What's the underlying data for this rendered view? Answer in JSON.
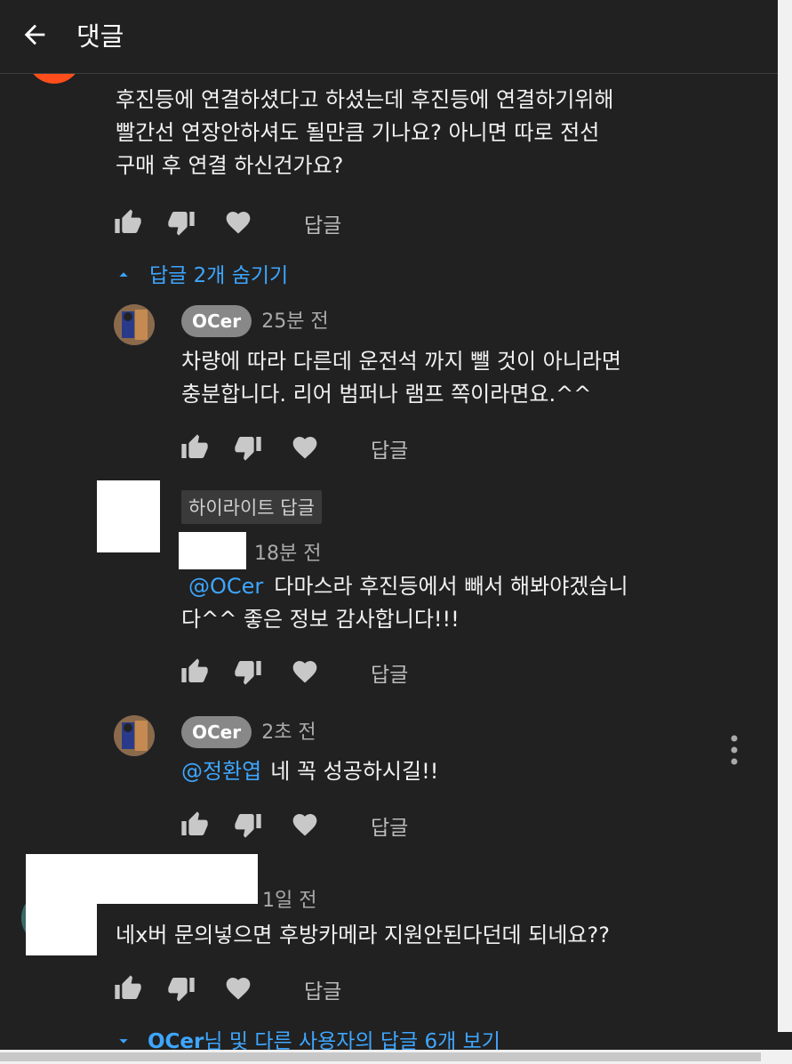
{
  "header": {
    "title": "댓글",
    "back_icon": "arrow-left-icon"
  },
  "top_comment": {
    "text_lines": [
      "후진등에 연결하셨다고 하셨는데 후진등에 연결하기위해",
      "빨간선 연장안하셔도 될만큼 기나요? 아니면 따로 전선",
      "구매 후 연결 하신건가요?"
    ],
    "reply_label": "답글",
    "hide_replies": "답글 2개 숨기기"
  },
  "replies": [
    {
      "author": "OCer",
      "time": "25분 전",
      "text_lines": [
        "차량에 따라 다른데 운전석 까지 뺄 것이 아니라면",
        "충분합니다. 리어 범퍼나 램프 쪽이라면요.^^"
      ],
      "reply_label": "답글"
    },
    {
      "highlight": "하이라이트 답글",
      "time": "18분 전",
      "mention": "@OCer",
      "text_line1": "다마스라 후진등에서 빼서 해봐야겠습니",
      "text_line2": "다^^ 좋은 정보 감사합니다!!!",
      "reply_label": "답글"
    },
    {
      "author": "OCer",
      "time": "2초 전",
      "mention": "@정환엽",
      "text": "네 꼭 성공하시길!!",
      "reply_label": "답글"
    }
  ],
  "second_comment": {
    "time": "1일 전",
    "text": "네x버 문의넣으면 후방카메라 지원안된다던데 되네요??",
    "reply_label": "답글",
    "view_replies_author": "OCer",
    "view_replies_rest": "님 및 다른 사용자의 답글 6개 보기"
  },
  "colors": {
    "background": "#212121",
    "link": "#3ea6ff",
    "badge": "#888888",
    "avatar_partial": "#ff4e1c"
  },
  "icons": [
    "thumbs-up-icon",
    "thumbs-down-icon",
    "heart-icon",
    "caret-up-icon",
    "caret-down-icon",
    "more-vert-icon"
  ]
}
